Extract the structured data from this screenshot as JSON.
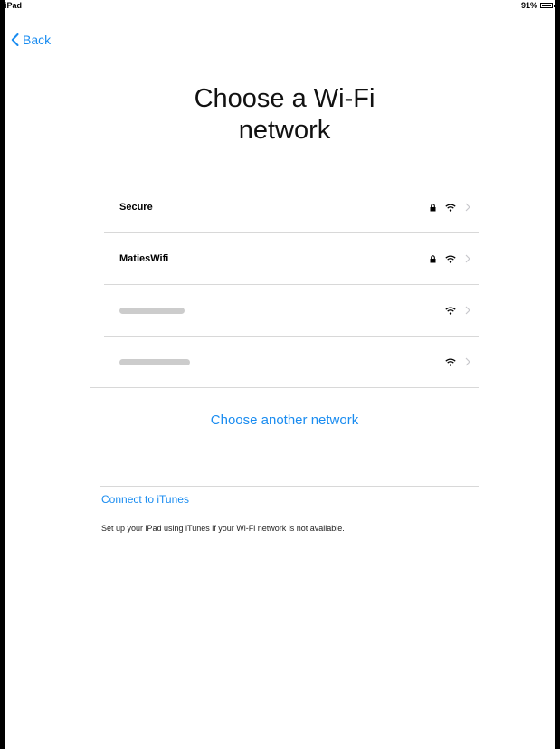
{
  "status_bar": {
    "device": "iPad",
    "battery": "91%"
  },
  "nav": {
    "back_label": "Back"
  },
  "header": {
    "title_line1": "Choose a Wi-Fi",
    "title_line2": "network"
  },
  "networks": [
    {
      "name": "Secure",
      "secured": true,
      "icons": [
        "lock-icon",
        "wifi-icon",
        "chevron-right-icon"
      ]
    },
    {
      "name": "MatiesWifi",
      "secured": true,
      "icons": [
        "lock-icon",
        "wifi-icon",
        "chevron-right-icon"
      ]
    },
    {
      "name": "",
      "secured": false,
      "blurred": true,
      "icons": [
        "wifi-icon",
        "chevron-right-icon"
      ]
    },
    {
      "name": "",
      "secured": false,
      "blurred": true,
      "icons": [
        "wifi-icon",
        "chevron-right-icon"
      ]
    }
  ],
  "other_network": {
    "label": "Choose another network"
  },
  "itunes": {
    "link_label": "Connect to iTunes",
    "description": "Set up your iPad using iTunes if your Wi-Fi network is not available."
  },
  "colors": {
    "accent": "#1a8cf0",
    "separator": "#d8d8d8",
    "text": "#111111"
  }
}
